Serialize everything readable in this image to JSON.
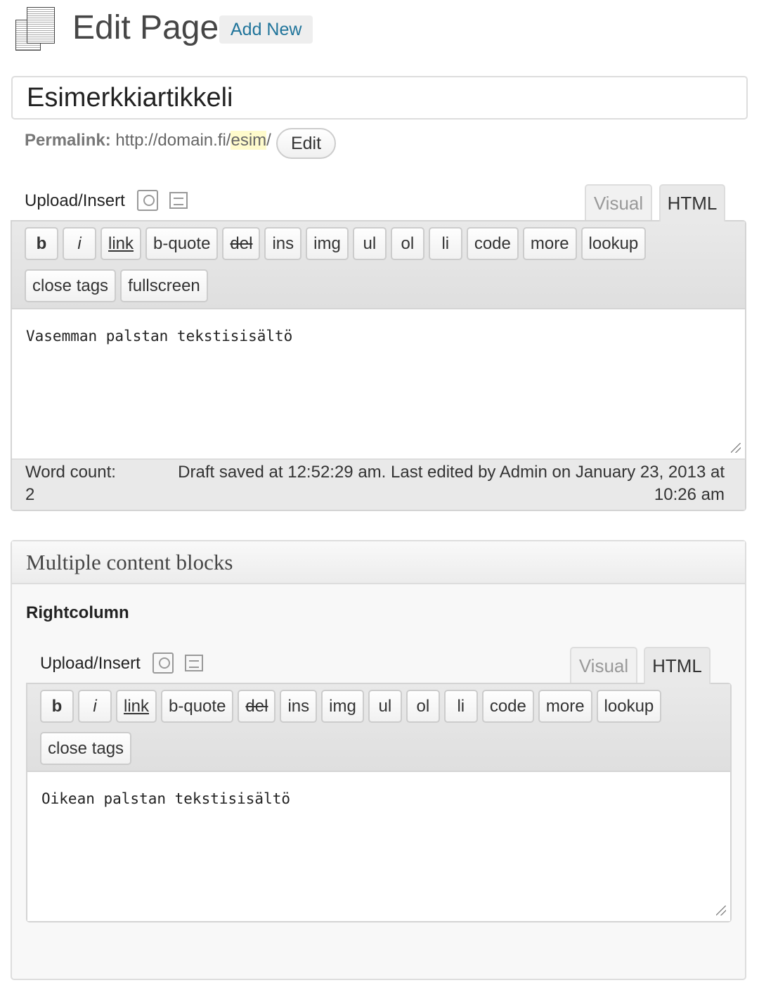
{
  "header": {
    "title": "Edit Page",
    "add_new": "Add New"
  },
  "post": {
    "title": "Esimerkkiartikkeli",
    "permalink_label": "Permalink:",
    "permalink_base": "http://domain.fi/",
    "permalink_slug": "esim",
    "permalink_tail": "/",
    "edit_label": "Edit"
  },
  "editor1": {
    "upload_label": "Upload/Insert",
    "tab_visual": "Visual",
    "tab_html": "HTML",
    "buttons": [
      "b",
      "i",
      "link",
      "b-quote",
      "del",
      "ins",
      "img",
      "ul",
      "ol",
      "li",
      "code",
      "more",
      "lookup",
      "close tags",
      "fullscreen"
    ],
    "content": "Vasemman palstan tekstisisältö",
    "word_count_label": "Word count:",
    "word_count": "2",
    "status_line1": "Draft saved at 12:52:29 am. Last edited by Admin on January 23, 2013 at",
    "status_line2": "10:26 am"
  },
  "panel": {
    "title": "Multiple content blocks",
    "block_label": "Rightcolumn"
  },
  "editor2": {
    "upload_label": "Upload/Insert",
    "tab_visual": "Visual",
    "tab_html": "HTML",
    "buttons": [
      "b",
      "i",
      "link",
      "b-quote",
      "del",
      "ins",
      "img",
      "ul",
      "ol",
      "li",
      "code",
      "more",
      "lookup",
      "close tags"
    ],
    "content": "Oikean palstan tekstisisältö"
  }
}
